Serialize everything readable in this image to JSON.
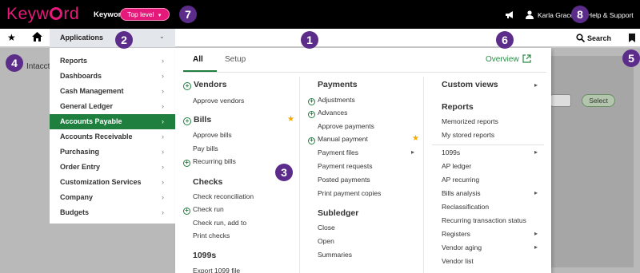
{
  "header": {
    "logo": "Keyword",
    "keyword_label": "Keyword",
    "level_pill": "Top level",
    "user_name": "Karla Grace",
    "help_label": "Help & Support"
  },
  "navbar": {
    "applications_label": "Applications",
    "search_label": "Search"
  },
  "background": {
    "company_label": "Intacct",
    "select_button": "Select"
  },
  "left_menu": [
    {
      "label": "Reports",
      "active": false
    },
    {
      "label": "Dashboards",
      "active": false
    },
    {
      "label": "Cash Management",
      "active": false
    },
    {
      "label": "General Ledger",
      "active": false
    },
    {
      "label": "Accounts Payable",
      "active": true
    },
    {
      "label": "Accounts Receivable",
      "active": false
    },
    {
      "label": "Purchasing",
      "active": false
    },
    {
      "label": "Order Entry",
      "active": false
    },
    {
      "label": "Customization Services",
      "active": false
    },
    {
      "label": "Company",
      "active": false
    },
    {
      "label": "Budgets",
      "active": false
    }
  ],
  "flyout": {
    "tabs": [
      "All",
      "Setup"
    ],
    "overview_link": "Overview",
    "col1": {
      "vendors_header": "Vendors",
      "approve_vendors": "Approve vendors",
      "bills_header": "Bills",
      "approve_bills": "Approve bills",
      "pay_bills": "Pay bills",
      "recurring_bills": "Recurring bills",
      "checks_header": "Checks",
      "check_reconciliation": "Check reconciliation",
      "check_run": "Check run",
      "check_run_add_to": "Check run, add to",
      "print_checks": "Print checks",
      "header_1099s": "1099s",
      "export_1099": "Export 1099 file"
    },
    "col2": {
      "payments_header": "Payments",
      "adjustments": "Adjustments",
      "advances": "Advances",
      "approve_payments": "Approve payments",
      "manual_payment": "Manual payment",
      "payment_files": "Payment files",
      "payment_requests": "Payment requests",
      "posted_payments": "Posted payments",
      "print_payment_copies": "Print payment copies",
      "subledger_header": "Subledger",
      "close": "Close",
      "open": "Open",
      "summaries": "Summaries"
    },
    "col3": {
      "custom_views_header": "Custom views",
      "reports_header": "Reports",
      "memorized_reports": "Memorized reports",
      "my_stored_reports": "My stored reports",
      "r_1099s": "1099s",
      "ap_ledger": "AP ledger",
      "ap_recurring": "AP recurring",
      "bills_analysis": "Bills analysis",
      "reclassification": "Reclassification",
      "recurring_transaction_status": "Recurring transaction status",
      "registers": "Registers",
      "vendor_aging": "Vendor aging",
      "vendor_list": "Vendor list"
    }
  },
  "callouts": [
    "1",
    "2",
    "3",
    "4",
    "5",
    "6",
    "7",
    "8"
  ],
  "colors": {
    "brand_pink": "#e5197a",
    "accent_green": "#1f7f3e",
    "callout_purple": "#5b2c8a",
    "star_gold": "#f2a900"
  },
  "icons": [
    "star-icon",
    "home-icon",
    "megaphone-icon",
    "user-icon",
    "search-icon",
    "bookmark-icon",
    "external-link-icon",
    "plus-circle-icon",
    "chevron-right-icon"
  ]
}
